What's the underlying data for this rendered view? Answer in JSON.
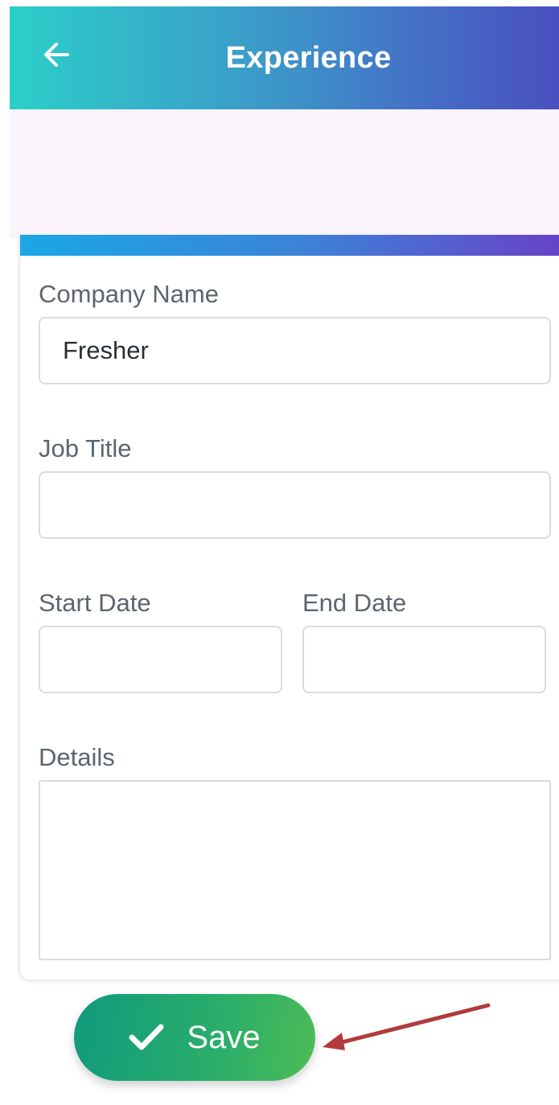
{
  "app_bar": {
    "title": "Experience",
    "back_icon": "arrow-left-icon"
  },
  "form": {
    "company_name": {
      "label": "Company Name",
      "value": "Fresher"
    },
    "job_title": {
      "label": "Job Title",
      "value": ""
    },
    "start_date": {
      "label": "Start Date",
      "value": ""
    },
    "end_date": {
      "label": "End Date",
      "value": ""
    },
    "details": {
      "label": "Details",
      "value": ""
    }
  },
  "save_button": {
    "label": "Save",
    "icon": "check-icon"
  },
  "colors": {
    "app_bar_start": "#2ccfc9",
    "app_bar_end": "#4a4fc0",
    "save_start": "#109a7d",
    "save_end": "#4dbb55",
    "annotation_arrow": "#b23a3a"
  }
}
